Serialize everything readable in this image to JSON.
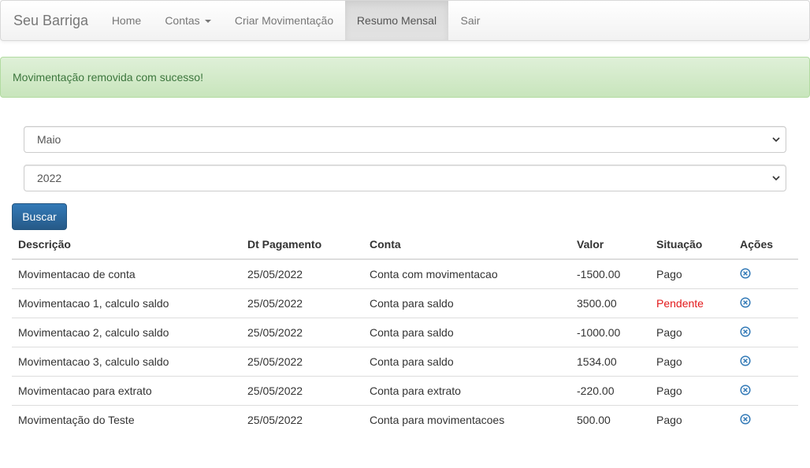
{
  "navbar": {
    "brand": "Seu Barriga",
    "items": [
      {
        "label": "Home"
      },
      {
        "label": "Contas"
      },
      {
        "label": "Criar Movimentação"
      },
      {
        "label": "Resumo Mensal"
      },
      {
        "label": "Sair"
      }
    ],
    "active": "Resumo Mensal"
  },
  "alert": {
    "message": "Movimentação removida com sucesso!"
  },
  "filters": {
    "month": "Maio",
    "year": "2022",
    "search_button": "Buscar"
  },
  "table": {
    "headers": [
      "Descrição",
      "Dt Pagamento",
      "Conta",
      "Valor",
      "Situação",
      "Ações"
    ],
    "rows": [
      {
        "descricao": "Movimentacao de conta",
        "data": "25/05/2022",
        "conta": "Conta com movimentacao",
        "valor": "-1500.00",
        "situacao": "Pago"
      },
      {
        "descricao": "Movimentacao 1, calculo saldo",
        "data": "25/05/2022",
        "conta": "Conta para saldo",
        "valor": "3500.00",
        "situacao": "Pendente"
      },
      {
        "descricao": "Movimentacao 2, calculo saldo",
        "data": "25/05/2022",
        "conta": "Conta para saldo",
        "valor": "-1000.00",
        "situacao": "Pago"
      },
      {
        "descricao": "Movimentacao 3, calculo saldo",
        "data": "25/05/2022",
        "conta": "Conta para saldo",
        "valor": "1534.00",
        "situacao": "Pago"
      },
      {
        "descricao": "Movimentacao para extrato",
        "data": "25/05/2022",
        "conta": "Conta para extrato",
        "valor": "-220.00",
        "situacao": "Pago"
      },
      {
        "descricao": "Movimentação do Teste",
        "data": "25/05/2022",
        "conta": "Conta para movimentacoes",
        "valor": "500.00",
        "situacao": "Pago"
      }
    ],
    "action_icon": "remove-circle-icon"
  },
  "colors": {
    "primary": "#337ab7",
    "pending": "#e3191b",
    "success_text": "#3c763d",
    "success_bg": "#dff0d8"
  }
}
